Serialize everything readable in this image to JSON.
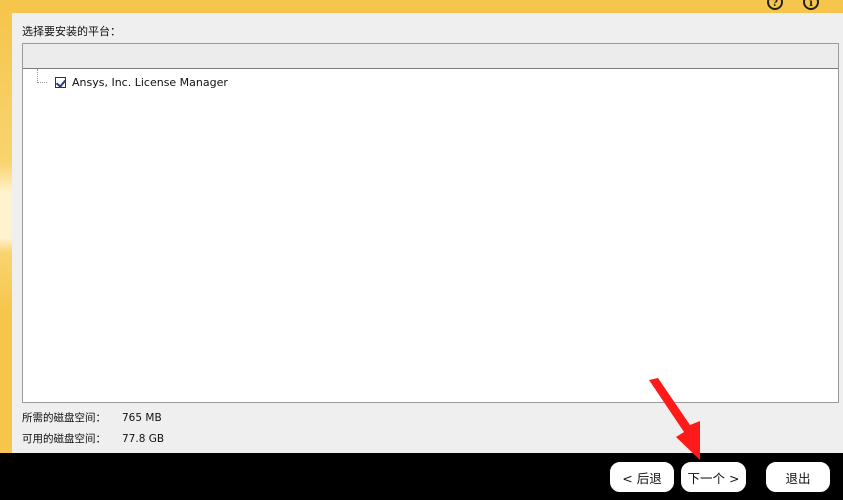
{
  "header": {
    "help_glyph": "?",
    "info_glyph": "i"
  },
  "content": {
    "prompt": "选择要安装的平台：",
    "tree_items": [
      {
        "label": "Ansys, Inc. License Manager",
        "checked": true
      }
    ]
  },
  "disk": {
    "required_label": "所需的磁盘空间：",
    "required_value": "765 MB",
    "available_label": "可用的磁盘空间：",
    "available_value": "77.8 GB"
  },
  "footer": {
    "back_label": "< 后退",
    "next_label": "下一个 >",
    "exit_label": "退出"
  },
  "colors": {
    "accent_yellow": "#f6c64c",
    "annotation_arrow": "#ff1a1a"
  },
  "icons": {
    "help": "question-mark-circle-icon",
    "info": "info-circle-icon",
    "annotation": "red-arrow-annotation"
  }
}
